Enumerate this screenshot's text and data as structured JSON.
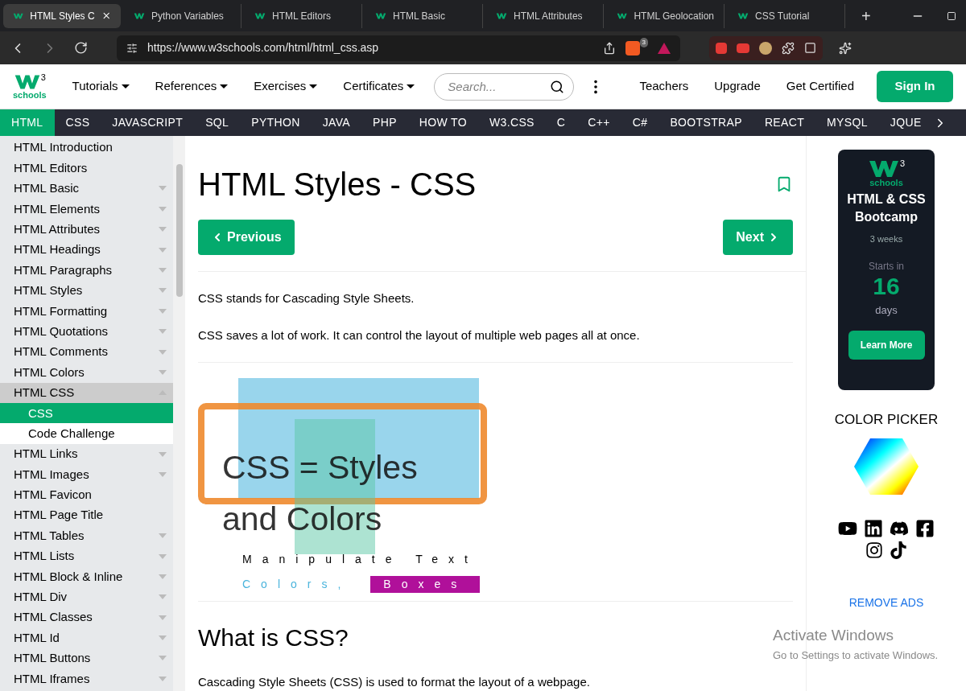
{
  "browser": {
    "tabs": [
      {
        "title": "HTML Styles C",
        "selected": true
      },
      {
        "title": "Python Variables",
        "selected": false
      },
      {
        "title": "HTML Editors",
        "selected": false
      },
      {
        "title": "HTML Basic",
        "selected": false
      },
      {
        "title": "HTML Attributes",
        "selected": false
      },
      {
        "title": "HTML Geolocation",
        "selected": false
      },
      {
        "title": "CSS Tutorial",
        "selected": false
      }
    ],
    "new_tab": "+",
    "url": "https://www.w3schools.com/html/html_css.asp",
    "shield_count": "3"
  },
  "header": {
    "logo": {
      "sup": "3",
      "word": "schools"
    },
    "menus": [
      "Tutorials",
      "References",
      "Exercises",
      "Certificates"
    ],
    "search": {
      "placeholder": "Search..."
    },
    "links": [
      "Teachers",
      "Upgrade",
      "Get Certified"
    ],
    "sign_in": "Sign In"
  },
  "topnav": [
    {
      "label": "HTML",
      "selected": true
    },
    {
      "label": "CSS",
      "selected": false
    },
    {
      "label": "JAVASCRIPT",
      "selected": false
    },
    {
      "label": "SQL",
      "selected": false
    },
    {
      "label": "PYTHON",
      "selected": false
    },
    {
      "label": "JAVA",
      "selected": false
    },
    {
      "label": "PHP",
      "selected": false
    },
    {
      "label": "HOW TO",
      "selected": false
    },
    {
      "label": "W3.CSS",
      "selected": false
    },
    {
      "label": "C",
      "selected": false
    },
    {
      "label": "C++",
      "selected": false
    },
    {
      "label": "C#",
      "selected": false
    },
    {
      "label": "BOOTSTRAP",
      "selected": false
    },
    {
      "label": "REACT",
      "selected": false
    },
    {
      "label": "MYSQL",
      "selected": false
    },
    {
      "label": "JQUE",
      "selected": false
    }
  ],
  "sidebar": {
    "items": [
      {
        "label": "HTML Introduction",
        "expandable": false,
        "expanded": false,
        "selected": false
      },
      {
        "label": "HTML Editors",
        "expandable": false,
        "expanded": false,
        "selected": false
      },
      {
        "label": "HTML Basic",
        "expandable": true,
        "expanded": false,
        "selected": false
      },
      {
        "label": "HTML Elements",
        "expandable": true,
        "expanded": false,
        "selected": false
      },
      {
        "label": "HTML Attributes",
        "expandable": true,
        "expanded": false,
        "selected": false
      },
      {
        "label": "HTML Headings",
        "expandable": true,
        "expanded": false,
        "selected": false
      },
      {
        "label": "HTML Paragraphs",
        "expandable": true,
        "expanded": false,
        "selected": false
      },
      {
        "label": "HTML Styles",
        "expandable": true,
        "expanded": false,
        "selected": false
      },
      {
        "label": "HTML Formatting",
        "expandable": true,
        "expanded": false,
        "selected": false
      },
      {
        "label": "HTML Quotations",
        "expandable": true,
        "expanded": false,
        "selected": false
      },
      {
        "label": "HTML Comments",
        "expandable": true,
        "expanded": false,
        "selected": false
      },
      {
        "label": "HTML Colors",
        "expandable": true,
        "expanded": false,
        "selected": false
      },
      {
        "label": "HTML CSS",
        "expandable": true,
        "expanded": true,
        "selected": false,
        "children": [
          {
            "label": "CSS",
            "selected": true
          },
          {
            "label": "Code Challenge",
            "selected": false
          }
        ]
      },
      {
        "label": "HTML Links",
        "expandable": true,
        "expanded": false,
        "selected": false
      },
      {
        "label": "HTML Images",
        "expandable": true,
        "expanded": false,
        "selected": false
      },
      {
        "label": "HTML Favicon",
        "expandable": false,
        "expanded": false,
        "selected": false
      },
      {
        "label": "HTML Page Title",
        "expandable": false,
        "expanded": false,
        "selected": false
      },
      {
        "label": "HTML Tables",
        "expandable": true,
        "expanded": false,
        "selected": false
      },
      {
        "label": "HTML Lists",
        "expandable": true,
        "expanded": false,
        "selected": false
      },
      {
        "label": "HTML Block & Inline",
        "expandable": true,
        "expanded": false,
        "selected": false
      },
      {
        "label": "HTML Div",
        "expandable": true,
        "expanded": false,
        "selected": false
      },
      {
        "label": "HTML Classes",
        "expandable": true,
        "expanded": false,
        "selected": false
      },
      {
        "label": "HTML Id",
        "expandable": true,
        "expanded": false,
        "selected": false
      },
      {
        "label": "HTML Buttons",
        "expandable": true,
        "expanded": false,
        "selected": false
      },
      {
        "label": "HTML Iframes",
        "expandable": true,
        "expanded": false,
        "selected": false
      }
    ]
  },
  "main": {
    "title": "HTML Styles - CSS",
    "previous": "Previous",
    "next": "Next",
    "paragraphs": [
      "CSS stands for Cascading Style Sheets.",
      "CSS saves a lot of work. It can control the layout of multiple web pages all at once."
    ],
    "banner": {
      "line1": "CSS = Styles",
      "line2": "and Colors",
      "sub1": "Manipulate Text",
      "sub2a": "Colors,",
      "sub2b": "Boxes"
    },
    "heading2": "What is CSS?",
    "paragraph2": "Cascading Style Sheets (CSS) is used to format the layout of a webpage."
  },
  "right": {
    "ad": {
      "logo_sup": "3",
      "logo_word": "schools",
      "title": "HTML & CSS Bootcamp",
      "duration": "3 weeks",
      "starts": "Starts in",
      "count": "16",
      "unit": "days",
      "button": "Learn More"
    },
    "color_picker": "COLOR PICKER",
    "remove_ads": "REMOVE ADS"
  },
  "overlay": {
    "title": "Activate Windows",
    "text": "Go to Settings to activate Windows."
  }
}
